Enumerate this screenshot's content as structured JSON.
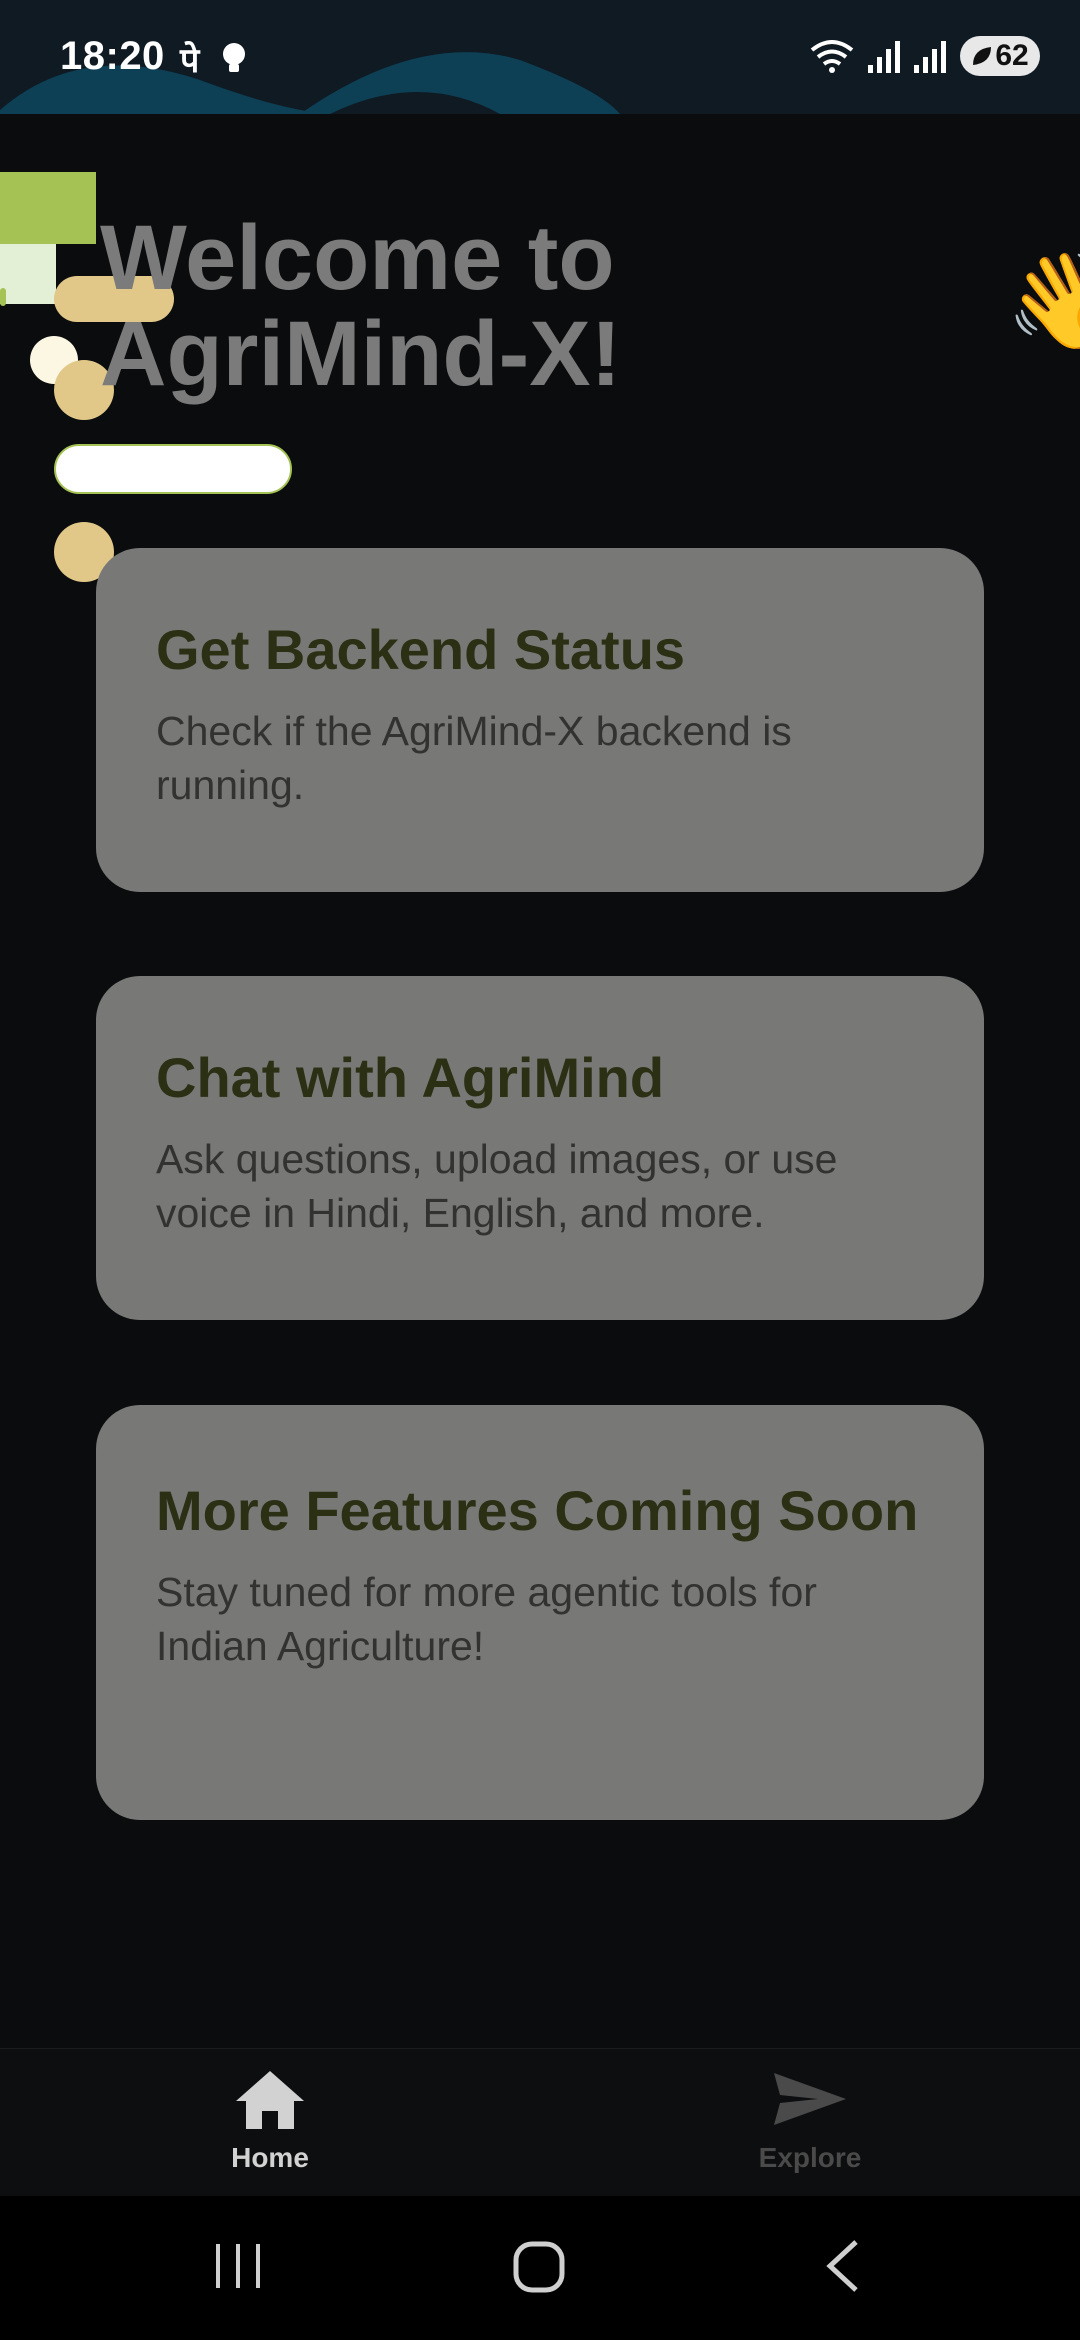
{
  "status_bar": {
    "time": "18:20",
    "indicator_glyph": "पे",
    "battery": "62"
  },
  "header": {
    "welcome_line1": "Welcome to",
    "welcome_line2": "AgriMind-X!",
    "emoji": "👋"
  },
  "cards": [
    {
      "title": "Get Backend Status",
      "description": "Check if the AgriMind-X backend is running."
    },
    {
      "title": "Chat with AgriMind",
      "description": "Ask questions, upload images, or use voice in Hindi, English, and more."
    },
    {
      "title": "More Features Coming Soon",
      "description": "Stay tuned for more agentic tools for Indian Agriculture!"
    }
  ],
  "bottom_nav": {
    "items": [
      {
        "label": "Home",
        "icon": "home-icon",
        "active": true
      },
      {
        "label": "Explore",
        "icon": "send-icon",
        "active": false
      }
    ]
  },
  "colors": {
    "background": "#0b0c0e",
    "card": "#787876",
    "card_title": "#2b2f14",
    "active_nav": "#d2d2d2",
    "inactive_nav": "#4a4a4a"
  }
}
